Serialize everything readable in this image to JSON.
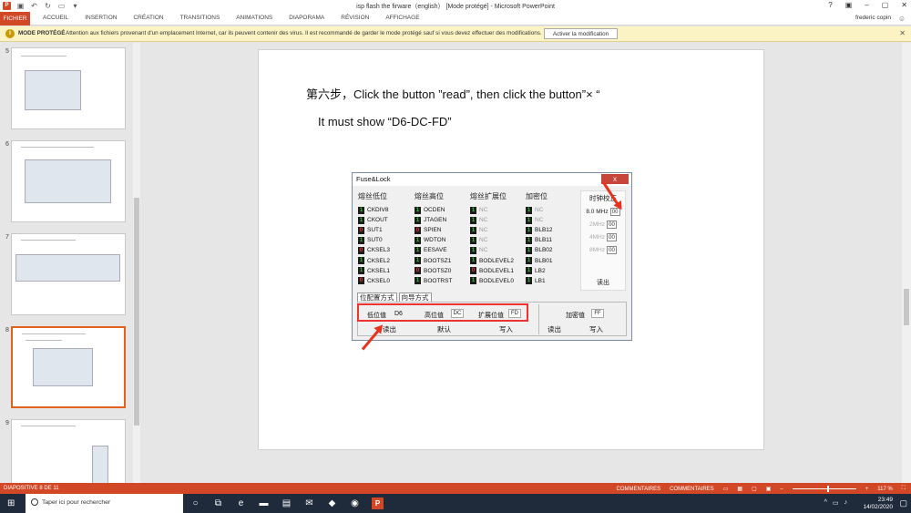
{
  "window": {
    "title": "isp flash the firware（english） [Mode protégé] - Microsoft PowerPoint",
    "user": "frederic copin"
  },
  "ribbon": {
    "file": "FICHIER",
    "tabs": [
      "ACCUEIL",
      "INSERTION",
      "CRÉATION",
      "TRANSITIONS",
      "ANIMATIONS",
      "DIAPORAMA",
      "RÉVISION",
      "AFFICHAGE"
    ]
  },
  "banner": {
    "title": "MODE PROTÉGÉ",
    "message": "Attention aux fichiers provenant d'un emplacement Internet, car ils peuvent contenir des virus. Il est recommandé de garder le mode protégé sauf si vous devez effectuer des modifications.",
    "button": "Activer la modification"
  },
  "thumbnails": [
    {
      "num": "5"
    },
    {
      "num": "6"
    },
    {
      "num": "7"
    },
    {
      "num": "8"
    },
    {
      "num": "9"
    }
  ],
  "slide": {
    "line1": "第六步，Click the button ”read”, then click the button”× “",
    "line2": "It must show “D6-DC-FD”"
  },
  "fuse": {
    "title": "Fuse&Lock",
    "close": "x",
    "headers": [
      "熔丝低位",
      "熔丝高位",
      "熔丝扩展位",
      "加密位"
    ],
    "col1": [
      {
        "b": "1",
        "l": "CKDIV8"
      },
      {
        "b": "1",
        "l": "CKOUT"
      },
      {
        "b": "0",
        "l": "SUT1"
      },
      {
        "b": "1",
        "l": "SUT0"
      },
      {
        "b": "0",
        "l": "CKSEL3"
      },
      {
        "b": "1",
        "l": "CKSEL2"
      },
      {
        "b": "1",
        "l": "CKSEL1"
      },
      {
        "b": "0",
        "l": "CKSEL0"
      }
    ],
    "col2": [
      {
        "b": "1",
        "l": "OCDEN"
      },
      {
        "b": "1",
        "l": "JTAGEN"
      },
      {
        "b": "0",
        "l": "SPIEN"
      },
      {
        "b": "1",
        "l": "WDTON"
      },
      {
        "b": "1",
        "l": "EESAVE"
      },
      {
        "b": "1",
        "l": "BOOTSZ1"
      },
      {
        "b": "0",
        "l": "BOOTSZ0"
      },
      {
        "b": "1",
        "l": "BOOTRST"
      }
    ],
    "col3": [
      {
        "b": "1",
        "l": "NC"
      },
      {
        "b": "1",
        "l": "NC"
      },
      {
        "b": "1",
        "l": "NC"
      },
      {
        "b": "1",
        "l": "NC"
      },
      {
        "b": "1",
        "l": "NC"
      },
      {
        "b": "1",
        "l": "BODLEVEL2"
      },
      {
        "b": "0",
        "l": "BODLEVEL1"
      },
      {
        "b": "1",
        "l": "BODLEVEL0"
      }
    ],
    "col4": [
      {
        "b": "1",
        "l": "NC"
      },
      {
        "b": "1",
        "l": "NC"
      },
      {
        "b": "1",
        "l": "BLB12"
      },
      {
        "b": "1",
        "l": "BLB11"
      },
      {
        "b": "1",
        "l": "BLB02"
      },
      {
        "b": "1",
        "l": "BLB01"
      },
      {
        "b": "1",
        "l": "LB2"
      },
      {
        "b": "1",
        "l": "LB1"
      }
    ],
    "clock": {
      "header": "时钟校正",
      "rows": [
        {
          "f": "8.0 MHz",
          "v": "00"
        },
        {
          "f": "2MHz",
          "v": "00"
        },
        {
          "f": "4MHz",
          "v": "00"
        },
        {
          "f": "8MHz",
          "v": "00"
        }
      ],
      "read": "读出"
    },
    "tabs": [
      "位配置方式",
      "向导方式"
    ],
    "low_label": "低位值",
    "low": "D6",
    "high_label": "高位值",
    "high": "DC",
    "ext_label": "扩展位值",
    "ext": "FD",
    "lock_label": "加密值",
    "lock": "FF",
    "btn_read": "读出",
    "btn_default": "默认",
    "btn_write": "写入",
    "btn_read2": "读出",
    "btn_write2": "写入"
  },
  "status": {
    "slide": "DIAPOSITIVE 8 DE 11",
    "notes": "COMMENTAIRES",
    "comments": "COMMENTAIRES",
    "zoom": "117 %"
  },
  "taskbar": {
    "search": "Taper ici pour rechercher",
    "time": "23:49",
    "date": "14/02/2020"
  }
}
